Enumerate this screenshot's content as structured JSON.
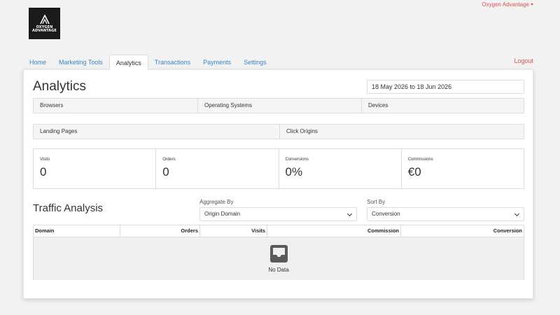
{
  "brand": {
    "line1": "OXYGEN",
    "line2": "ADVANTAGE"
  },
  "header": {
    "account_label": "Oxygen Advantage"
  },
  "tabs": [
    {
      "label": "Home"
    },
    {
      "label": "Marketing Tools"
    },
    {
      "label": "Analytics",
      "active": true
    },
    {
      "label": "Transactions"
    },
    {
      "label": "Payments"
    },
    {
      "label": "Settings"
    }
  ],
  "logout_label": "Logout",
  "page": {
    "title": "Analytics",
    "date_range": "18 May 2026 to 18 Jun 2026",
    "bar1": [
      "Browsers",
      "Operating Systems",
      "Devices"
    ],
    "bar2": [
      "Landing Pages",
      "Click Origins"
    ]
  },
  "stats": [
    {
      "label": "Visits",
      "value": "0"
    },
    {
      "label": "Orders",
      "value": "0"
    },
    {
      "label": "Conversions",
      "value": "0%"
    },
    {
      "label": "Commissions",
      "value": "€0"
    }
  ],
  "traffic": {
    "title": "Traffic Analysis",
    "aggregate_label": "Aggregate By",
    "aggregate_value": "Origin Domain",
    "sort_label": "Sort By",
    "sort_value": "Conversion",
    "columns": [
      "Domain",
      "Orders",
      "Visits",
      "Commission",
      "Conversion"
    ],
    "empty_text": "No Data"
  },
  "colors": {
    "link": "#3b83c4",
    "danger": "#d9534f",
    "logo_bg": "#1a1a1a"
  },
  "icons": {
    "empty": "inbox-icon",
    "dropdown": "chevron-down-icon"
  }
}
